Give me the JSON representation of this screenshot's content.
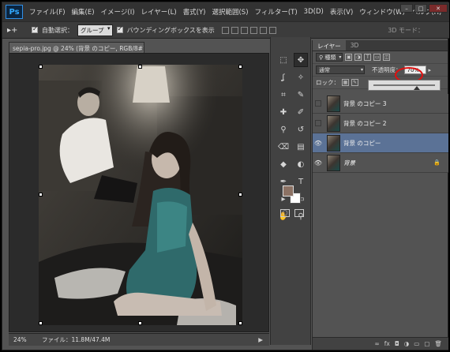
{
  "app": {
    "logo": "Ps"
  },
  "menu": [
    "ファイル(F)",
    "編集(E)",
    "イメージ(I)",
    "レイヤー(L)",
    "書式(Y)",
    "選択範囲(S)",
    "フィルター(T)",
    "3D(D)",
    "表示(V)",
    "ウィンドウ(W)",
    "ヘルプ(H)"
  ],
  "window_controls": {
    "minimize": "–",
    "maximize": "□",
    "close": "✕"
  },
  "options": {
    "tool_glyph": "▸+",
    "auto_select_label": "自動選択：",
    "auto_select_value": "グループ",
    "bounding_box_label": "バウンディングボックスを表示",
    "mode_3d_label": "3D モード："
  },
  "document": {
    "tab_title": "sepia-pro.jpg @ 24% (背景 のコピー, RGB/8#) *",
    "tab_close": "×"
  },
  "status": {
    "zoom": "24%",
    "file_info": "ファイル：11.8M/47.4M",
    "arrow": "▶"
  },
  "colors": {
    "foreground": "#8c7264",
    "background": "#ffffff",
    "accent": "#5b7296",
    "highlight_circle": "#e01010"
  },
  "tools": [
    "marquee-icon",
    "move-icon",
    "lasso-icon",
    "magic-wand-icon",
    "crop-icon",
    "eyedropper-icon",
    "spot-heal-icon",
    "brush-icon",
    "clone-stamp-icon",
    "history-brush-icon",
    "eraser-icon",
    "gradient-icon",
    "blur-icon",
    "dodge-icon",
    "pen-icon",
    "type-icon",
    "path-select-icon",
    "rectangle-icon",
    "hand-icon",
    "zoom-icon"
  ],
  "tool_glyphs": [
    "⬚",
    "✥",
    "ʆ",
    "✧",
    "⌗",
    "✎",
    "✚",
    "✐",
    "⚲",
    "↺",
    "⌫",
    "▤",
    "◆",
    "◐",
    "✒",
    "T",
    "▸",
    "▭",
    "✋",
    "⚲"
  ],
  "layers_panel": {
    "tabs": [
      "レイヤー",
      "3D"
    ],
    "filter_label": "種類",
    "blend_mode": "通常",
    "opacity_label": "不透明度：",
    "opacity_value": "70%",
    "opacity_percent": 70,
    "lock_label": "ロック：",
    "layers": [
      {
        "name": "背景 のコピー 3",
        "visible": false,
        "selected": false
      },
      {
        "name": "背景 のコピー 2",
        "visible": false,
        "selected": false
      },
      {
        "name": "背景 のコピー",
        "visible": true,
        "selected": true
      },
      {
        "name": "背景",
        "visible": true,
        "selected": false,
        "locked": true
      }
    ],
    "footer_icons": [
      "link-icon",
      "fx-icon",
      "mask-icon",
      "adjustment-icon",
      "group-icon",
      "new-layer-icon",
      "trash-icon"
    ],
    "footer_glyphs": [
      "∞",
      "fx",
      "◘",
      "◑",
      "▭",
      "▢",
      "🗑"
    ]
  }
}
